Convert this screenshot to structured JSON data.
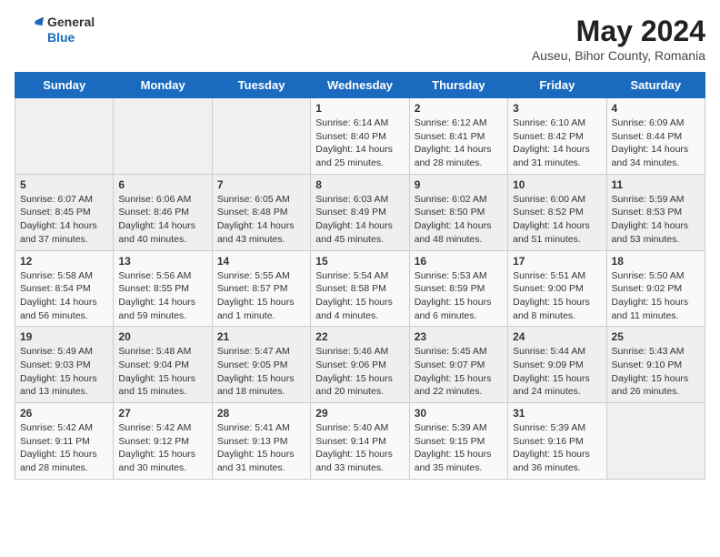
{
  "header": {
    "logo_general": "General",
    "logo_blue": "Blue",
    "month_year": "May 2024",
    "location": "Auseu, Bihor County, Romania"
  },
  "weekdays": [
    "Sunday",
    "Monday",
    "Tuesday",
    "Wednesday",
    "Thursday",
    "Friday",
    "Saturday"
  ],
  "weeks": [
    [
      {
        "day": null,
        "sunrise": null,
        "sunset": null,
        "daylight": null
      },
      {
        "day": null,
        "sunrise": null,
        "sunset": null,
        "daylight": null
      },
      {
        "day": null,
        "sunrise": null,
        "sunset": null,
        "daylight": null
      },
      {
        "day": "1",
        "sunrise": "6:14 AM",
        "sunset": "8:40 PM",
        "daylight": "14 hours and 25 minutes."
      },
      {
        "day": "2",
        "sunrise": "6:12 AM",
        "sunset": "8:41 PM",
        "daylight": "14 hours and 28 minutes."
      },
      {
        "day": "3",
        "sunrise": "6:10 AM",
        "sunset": "8:42 PM",
        "daylight": "14 hours and 31 minutes."
      },
      {
        "day": "4",
        "sunrise": "6:09 AM",
        "sunset": "8:44 PM",
        "daylight": "14 hours and 34 minutes."
      }
    ],
    [
      {
        "day": "5",
        "sunrise": "6:07 AM",
        "sunset": "8:45 PM",
        "daylight": "14 hours and 37 minutes."
      },
      {
        "day": "6",
        "sunrise": "6:06 AM",
        "sunset": "8:46 PM",
        "daylight": "14 hours and 40 minutes."
      },
      {
        "day": "7",
        "sunrise": "6:05 AM",
        "sunset": "8:48 PM",
        "daylight": "14 hours and 43 minutes."
      },
      {
        "day": "8",
        "sunrise": "6:03 AM",
        "sunset": "8:49 PM",
        "daylight": "14 hours and 45 minutes."
      },
      {
        "day": "9",
        "sunrise": "6:02 AM",
        "sunset": "8:50 PM",
        "daylight": "14 hours and 48 minutes."
      },
      {
        "day": "10",
        "sunrise": "6:00 AM",
        "sunset": "8:52 PM",
        "daylight": "14 hours and 51 minutes."
      },
      {
        "day": "11",
        "sunrise": "5:59 AM",
        "sunset": "8:53 PM",
        "daylight": "14 hours and 53 minutes."
      }
    ],
    [
      {
        "day": "12",
        "sunrise": "5:58 AM",
        "sunset": "8:54 PM",
        "daylight": "14 hours and 56 minutes."
      },
      {
        "day": "13",
        "sunrise": "5:56 AM",
        "sunset": "8:55 PM",
        "daylight": "14 hours and 59 minutes."
      },
      {
        "day": "14",
        "sunrise": "5:55 AM",
        "sunset": "8:57 PM",
        "daylight": "15 hours and 1 minute."
      },
      {
        "day": "15",
        "sunrise": "5:54 AM",
        "sunset": "8:58 PM",
        "daylight": "15 hours and 4 minutes."
      },
      {
        "day": "16",
        "sunrise": "5:53 AM",
        "sunset": "8:59 PM",
        "daylight": "15 hours and 6 minutes."
      },
      {
        "day": "17",
        "sunrise": "5:51 AM",
        "sunset": "9:00 PM",
        "daylight": "15 hours and 8 minutes."
      },
      {
        "day": "18",
        "sunrise": "5:50 AM",
        "sunset": "9:02 PM",
        "daylight": "15 hours and 11 minutes."
      }
    ],
    [
      {
        "day": "19",
        "sunrise": "5:49 AM",
        "sunset": "9:03 PM",
        "daylight": "15 hours and 13 minutes."
      },
      {
        "day": "20",
        "sunrise": "5:48 AM",
        "sunset": "9:04 PM",
        "daylight": "15 hours and 15 minutes."
      },
      {
        "day": "21",
        "sunrise": "5:47 AM",
        "sunset": "9:05 PM",
        "daylight": "15 hours and 18 minutes."
      },
      {
        "day": "22",
        "sunrise": "5:46 AM",
        "sunset": "9:06 PM",
        "daylight": "15 hours and 20 minutes."
      },
      {
        "day": "23",
        "sunrise": "5:45 AM",
        "sunset": "9:07 PM",
        "daylight": "15 hours and 22 minutes."
      },
      {
        "day": "24",
        "sunrise": "5:44 AM",
        "sunset": "9:09 PM",
        "daylight": "15 hours and 24 minutes."
      },
      {
        "day": "25",
        "sunrise": "5:43 AM",
        "sunset": "9:10 PM",
        "daylight": "15 hours and 26 minutes."
      }
    ],
    [
      {
        "day": "26",
        "sunrise": "5:42 AM",
        "sunset": "9:11 PM",
        "daylight": "15 hours and 28 minutes."
      },
      {
        "day": "27",
        "sunrise": "5:42 AM",
        "sunset": "9:12 PM",
        "daylight": "15 hours and 30 minutes."
      },
      {
        "day": "28",
        "sunrise": "5:41 AM",
        "sunset": "9:13 PM",
        "daylight": "15 hours and 31 minutes."
      },
      {
        "day": "29",
        "sunrise": "5:40 AM",
        "sunset": "9:14 PM",
        "daylight": "15 hours and 33 minutes."
      },
      {
        "day": "30",
        "sunrise": "5:39 AM",
        "sunset": "9:15 PM",
        "daylight": "15 hours and 35 minutes."
      },
      {
        "day": "31",
        "sunrise": "5:39 AM",
        "sunset": "9:16 PM",
        "daylight": "15 hours and 36 minutes."
      },
      {
        "day": null,
        "sunrise": null,
        "sunset": null,
        "daylight": null
      }
    ]
  ]
}
